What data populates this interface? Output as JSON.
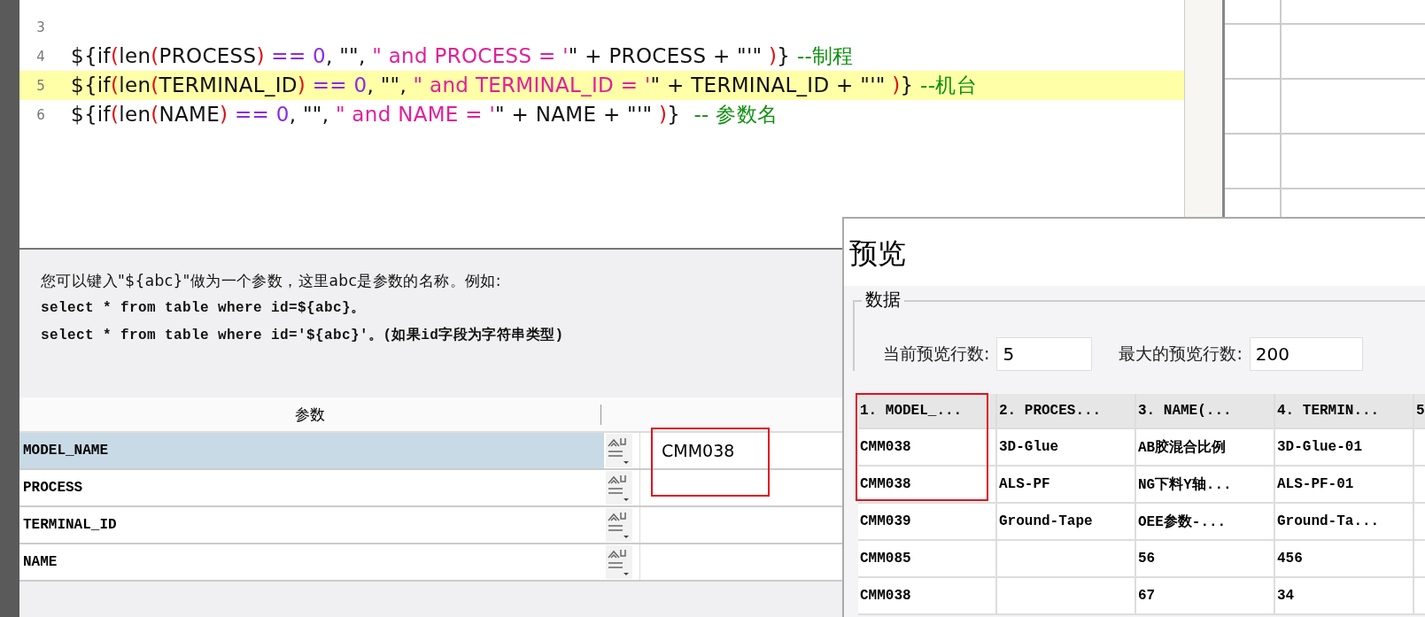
{
  "editor": {
    "lines": [
      {
        "number": "3",
        "highlighted": false
      },
      {
        "number": "4",
        "highlighted": false,
        "tokens": [
          {
            "kind": "plain",
            "text": "${if"
          },
          {
            "kind": "paren",
            "text": "("
          },
          {
            "kind": "plain",
            "text": "len"
          },
          {
            "kind": "paren",
            "text": "("
          },
          {
            "kind": "plain",
            "text": "PROCESS"
          },
          {
            "kind": "paren",
            "text": ")"
          },
          {
            "kind": "operator",
            "text": " == 0"
          },
          {
            "kind": "plain",
            "text": ", \"\", "
          },
          {
            "kind": "string",
            "text": "\" and PROCESS = '"
          },
          {
            "kind": "plain",
            "text": "\" + PROCESS + \"'\" "
          },
          {
            "kind": "paren",
            "text": ")"
          },
          {
            "kind": "plain",
            "text": "} "
          },
          {
            "kind": "comment",
            "text": "--制程"
          }
        ]
      },
      {
        "number": "5",
        "highlighted": true,
        "tokens": [
          {
            "kind": "plain",
            "text": "${if"
          },
          {
            "kind": "paren",
            "text": "("
          },
          {
            "kind": "plain",
            "text": "len"
          },
          {
            "kind": "paren",
            "text": "("
          },
          {
            "kind": "plain",
            "text": "TERMINAL_ID"
          },
          {
            "kind": "paren",
            "text": ")"
          },
          {
            "kind": "operator",
            "text": " == 0"
          },
          {
            "kind": "plain",
            "text": ", \"\", "
          },
          {
            "kind": "string",
            "text": "\" and TERMINAL_ID = '"
          },
          {
            "kind": "plain",
            "text": "\" + TERMINAL_ID + \"'\" "
          },
          {
            "kind": "paren",
            "text": ")"
          },
          {
            "kind": "plain",
            "text": "} "
          },
          {
            "kind": "comment",
            "text": "--机台"
          }
        ]
      },
      {
        "number": "6",
        "highlighted": false,
        "tokens": [
          {
            "kind": "plain",
            "text": "${if"
          },
          {
            "kind": "paren",
            "text": "("
          },
          {
            "kind": "plain",
            "text": "len"
          },
          {
            "kind": "paren",
            "text": "("
          },
          {
            "kind": "plain",
            "text": "NAME"
          },
          {
            "kind": "paren",
            "text": ")"
          },
          {
            "kind": "operator",
            "text": " == 0"
          },
          {
            "kind": "plain",
            "text": ", \"\", "
          },
          {
            "kind": "string",
            "text": "\" and NAME = '"
          },
          {
            "kind": "plain",
            "text": "\" + NAME + \"'\" "
          },
          {
            "kind": "paren",
            "text": ")"
          },
          {
            "kind": "plain",
            "text": "}  "
          },
          {
            "kind": "comment",
            "text": "-- 参数名"
          }
        ]
      }
    ]
  },
  "help_text": [
    "您可以键入\"${abc}\"做为一个参数，这里abc是参数的名称。例如:",
    "select * from table where id=${abc}。",
    "select * from table where id='${abc}'。(如果id字段为字符串类型)"
  ],
  "parameters": {
    "header": "参数",
    "rows": [
      {
        "name": "MODEL_NAME",
        "value": "CMM038",
        "selected": true
      },
      {
        "name": "PROCESS",
        "value": "",
        "selected": false
      },
      {
        "name": "TERMINAL_ID",
        "value": "",
        "selected": false
      },
      {
        "name": "NAME",
        "value": "",
        "selected": false
      }
    ]
  },
  "preview": {
    "title": "预览",
    "group": "数据",
    "current_rows_label": "当前预览行数:",
    "current_rows": "5",
    "max_rows_label": "最大的预览行数:",
    "max_rows": "200",
    "columns": [
      "1. MODEL_...",
      "2. PROCES...",
      "3. NAME(...",
      "4. TERMIN...",
      "5"
    ],
    "rows": [
      [
        "CMM038",
        "3D-Glue",
        "AB胶混合比例",
        "3D-Glue-01"
      ],
      [
        "CMM038",
        "ALS-PF",
        "NG下料Y轴...",
        "ALS-PF-01"
      ],
      [
        "CMM039",
        "Ground-Tape",
        "OEE参数-...",
        "Ground-Ta..."
      ],
      [
        "CMM085",
        "",
        "56",
        "456"
      ],
      [
        "CMM038",
        "",
        "67",
        "34"
      ]
    ]
  }
}
